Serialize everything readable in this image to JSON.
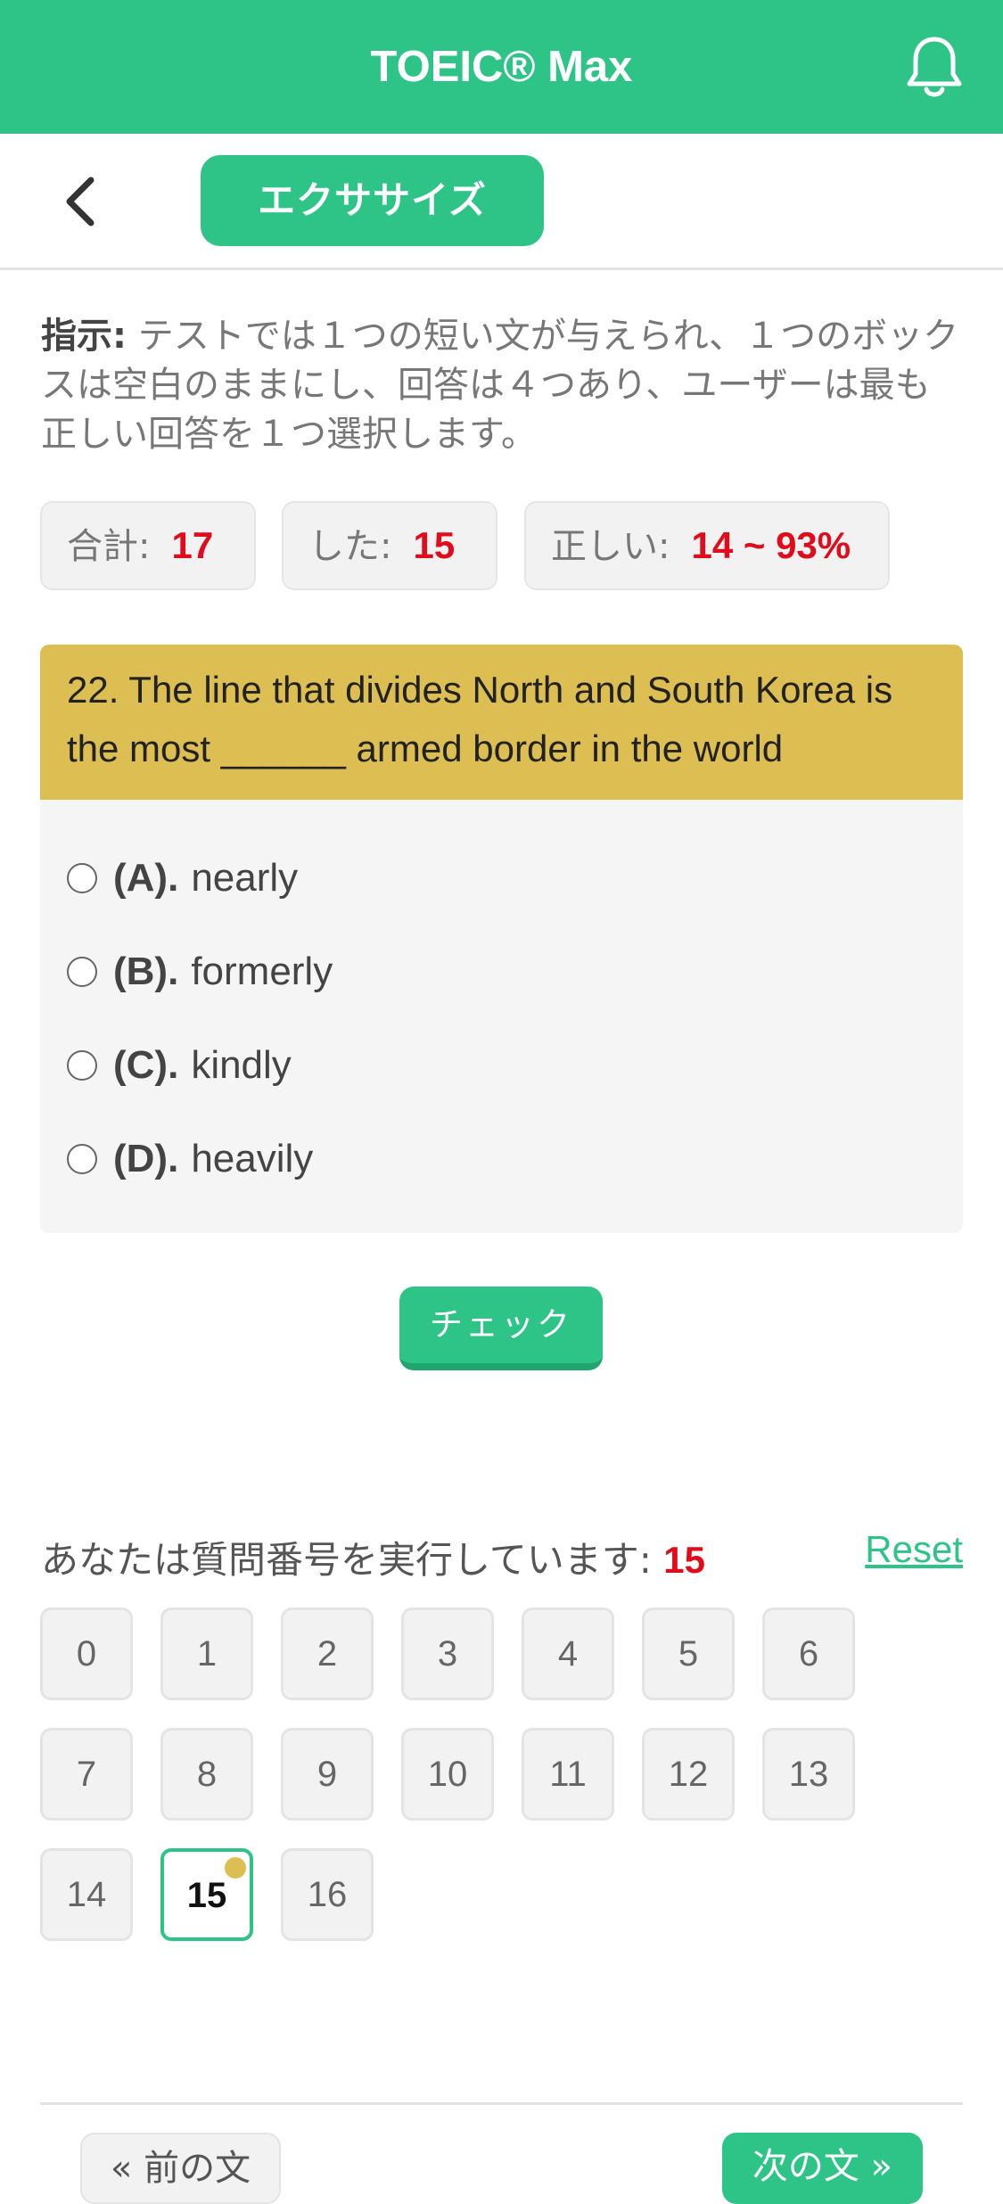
{
  "header": {
    "title": "TOEIC® Max",
    "bell_icon": "bell-icon"
  },
  "subbar": {
    "back_icon": "chevron-left-icon",
    "mode_label": "エクササイズ"
  },
  "instructions": {
    "label": "指示:",
    "text": " テストでは１つの短い文が与えられ、１つのボックスは空白のままにし、回答は４つあり、ユーザーは最も正しい回答を１つ選択します。"
  },
  "stats": {
    "total_label": "合計:",
    "total_value": "17",
    "done_label": "した:",
    "done_value": "15",
    "correct_label": "正しい:",
    "correct_value": "14 ~ 93%"
  },
  "question": {
    "text": "22. The line that divides North and South Korea is the most ______ armed border in the world",
    "options": [
      {
        "label": "(A).",
        "text": "nearly"
      },
      {
        "label": "(B).",
        "text": "formerly"
      },
      {
        "label": "(C).",
        "text": "kindly"
      },
      {
        "label": "(D).",
        "text": "heavily"
      }
    ]
  },
  "check_button": "チェック",
  "progress": {
    "label": "あなたは質問番号を実行しています:",
    "current": "15",
    "reset_label": "Reset"
  },
  "question_numbers": [
    "0",
    "1",
    "2",
    "3",
    "4",
    "5",
    "6",
    "7",
    "8",
    "9",
    "10",
    "11",
    "12",
    "13",
    "14",
    "15",
    "16"
  ],
  "footer": {
    "prev_label": "« 前の文",
    "next_label": "次の文 »"
  },
  "colors": {
    "primary": "#2ec487",
    "question_bg": "#dcbe52",
    "accent_red": "#e00b1b"
  }
}
